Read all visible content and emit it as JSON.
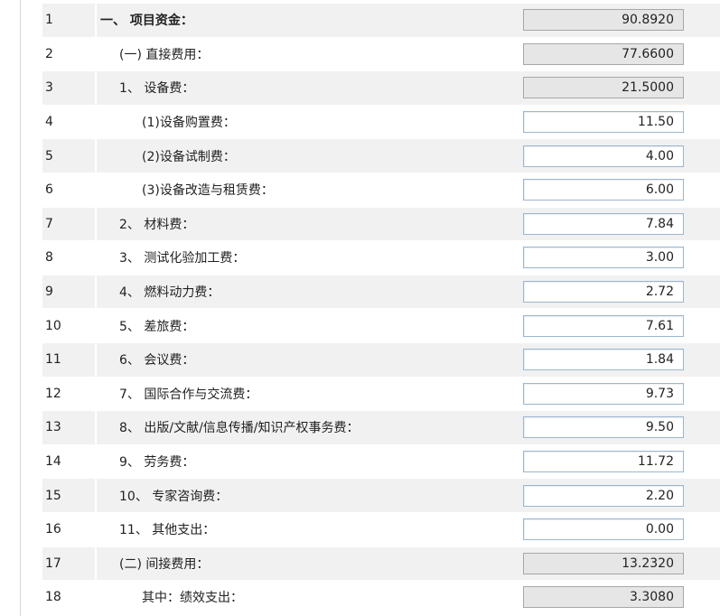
{
  "rows": [
    {
      "no": "1",
      "label": "一、 项目资金：",
      "value": "90.8920",
      "level": 0,
      "editable": false
    },
    {
      "no": "2",
      "label": "(一) 直接费用：",
      "value": "77.6600",
      "level": 1,
      "editable": false
    },
    {
      "no": "3",
      "label": "1、 设备费：",
      "value": "21.5000",
      "level": 1,
      "editable": false
    },
    {
      "no": "4",
      "label": "(1)设备购置费：",
      "value": "11.50",
      "level": 2,
      "editable": true
    },
    {
      "no": "5",
      "label": "(2)设备试制费：",
      "value": "4.00",
      "level": 2,
      "editable": true
    },
    {
      "no": "6",
      "label": "(3)设备改造与租赁费：",
      "value": "6.00",
      "level": 2,
      "editable": true
    },
    {
      "no": "7",
      "label": "2、 材料费：",
      "value": "7.84",
      "level": 1,
      "editable": true
    },
    {
      "no": "8",
      "label": "3、 测试化验加工费：",
      "value": "3.00",
      "level": 1,
      "editable": true
    },
    {
      "no": "9",
      "label": "4、 燃料动力费：",
      "value": "2.72",
      "level": 1,
      "editable": true
    },
    {
      "no": "10",
      "label": "5、 差旅费：",
      "value": "7.61",
      "level": 1,
      "editable": true
    },
    {
      "no": "11",
      "label": "6、 会议费：",
      "value": "1.84",
      "level": 1,
      "editable": true
    },
    {
      "no": "12",
      "label": "7、 国际合作与交流费：",
      "value": "9.73",
      "level": 1,
      "editable": true
    },
    {
      "no": "13",
      "label": "8、 出版/文献/信息传播/知识产权事务费：",
      "value": "9.50",
      "level": 1,
      "editable": true
    },
    {
      "no": "14",
      "label": "9、 劳务费：",
      "value": "11.72",
      "level": 1,
      "editable": true
    },
    {
      "no": "15",
      "label": "10、 专家咨询费：",
      "value": "2.20",
      "level": 1,
      "editable": true
    },
    {
      "no": "16",
      "label": "11、 其他支出：",
      "value": "0.00",
      "level": 1,
      "editable": true
    },
    {
      "no": "17",
      "label": "(二) 间接费用：",
      "value": "13.2320",
      "level": 1,
      "editable": false
    },
    {
      "no": "18",
      "label": "其中：绩效支出：",
      "value": "3.3080",
      "level": 2,
      "editable": false
    }
  ]
}
